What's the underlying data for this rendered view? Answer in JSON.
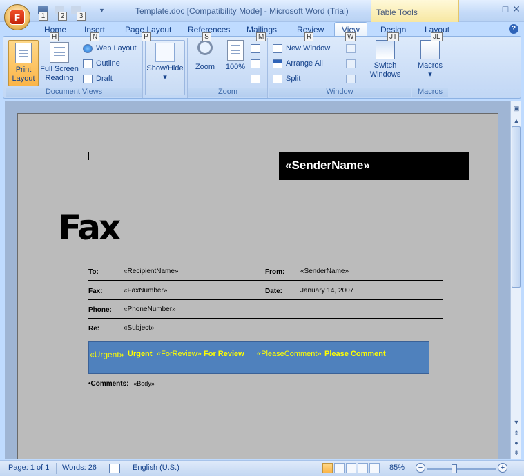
{
  "window": {
    "title": "Template.doc [Compatibility Mode] - Microsoft Word (Trial)",
    "context_tab": "Table Tools",
    "office_button_keytip": "F",
    "minimize": "–",
    "maximize": "□",
    "close": "✕"
  },
  "qat": {
    "keytips": [
      "1",
      "2",
      "3"
    ]
  },
  "tabs": [
    {
      "label": "Home",
      "keytip": "H"
    },
    {
      "label": "Insert",
      "keytip": "N"
    },
    {
      "label": "Page Layout",
      "keytip": "P"
    },
    {
      "label": "References",
      "keytip": "S"
    },
    {
      "label": "Mailings",
      "keytip": "M"
    },
    {
      "label": "Review",
      "keytip": "R"
    },
    {
      "label": "View",
      "keytip": "W"
    },
    {
      "label": "Design",
      "keytip": "JT"
    },
    {
      "label": "Layout",
      "keytip": "JL"
    }
  ],
  "ribbon": {
    "document_views": {
      "label": "Document Views",
      "print_layout": [
        "Print",
        "Layout"
      ],
      "full_screen": [
        "Full Screen",
        "Reading"
      ],
      "web_layout": "Web Layout",
      "outline": "Outline",
      "draft": "Draft"
    },
    "show_hide": {
      "label": "Show/Hide"
    },
    "zoom": {
      "label": "Zoom",
      "zoom_btn": "Zoom",
      "hundred": "100%"
    },
    "window": {
      "label": "Window",
      "new_window": "New Window",
      "arrange_all": "Arrange All",
      "split": "Split",
      "switch_windows": [
        "Switch",
        "Windows"
      ]
    },
    "macros": {
      "label": "Macros",
      "btn": "Macros"
    }
  },
  "document": {
    "sender_name": "«SenderName»",
    "title": "Fax",
    "fields": [
      {
        "label": "To:",
        "value": "«RecipientName»",
        "label2": "From:",
        "value2": "«SenderName»"
      },
      {
        "label": "Fax:",
        "value": "«FaxNumber»",
        "label2": "Date:",
        "value2": "January 14, 2007"
      },
      {
        "label": "Phone:",
        "value": "«PhoneNumber»",
        "label2": "",
        "value2": ""
      },
      {
        "label": "Re:",
        "value": "«Subject»",
        "label2": "",
        "value2": ""
      }
    ],
    "urgent_bar": {
      "urgent_field": "«Urgent»",
      "urgent": "Urgent",
      "review_field": "«ForReview»",
      "review": "For Review",
      "comment_field": "«PleaseComment»",
      "comment": "Please Comment"
    },
    "comments_label": "•Comments:",
    "comments_value": "«Body»"
  },
  "statusbar": {
    "page": "Page: 1 of 1",
    "words": "Words: 26",
    "language": "English (U.S.)",
    "zoom": "85%"
  }
}
